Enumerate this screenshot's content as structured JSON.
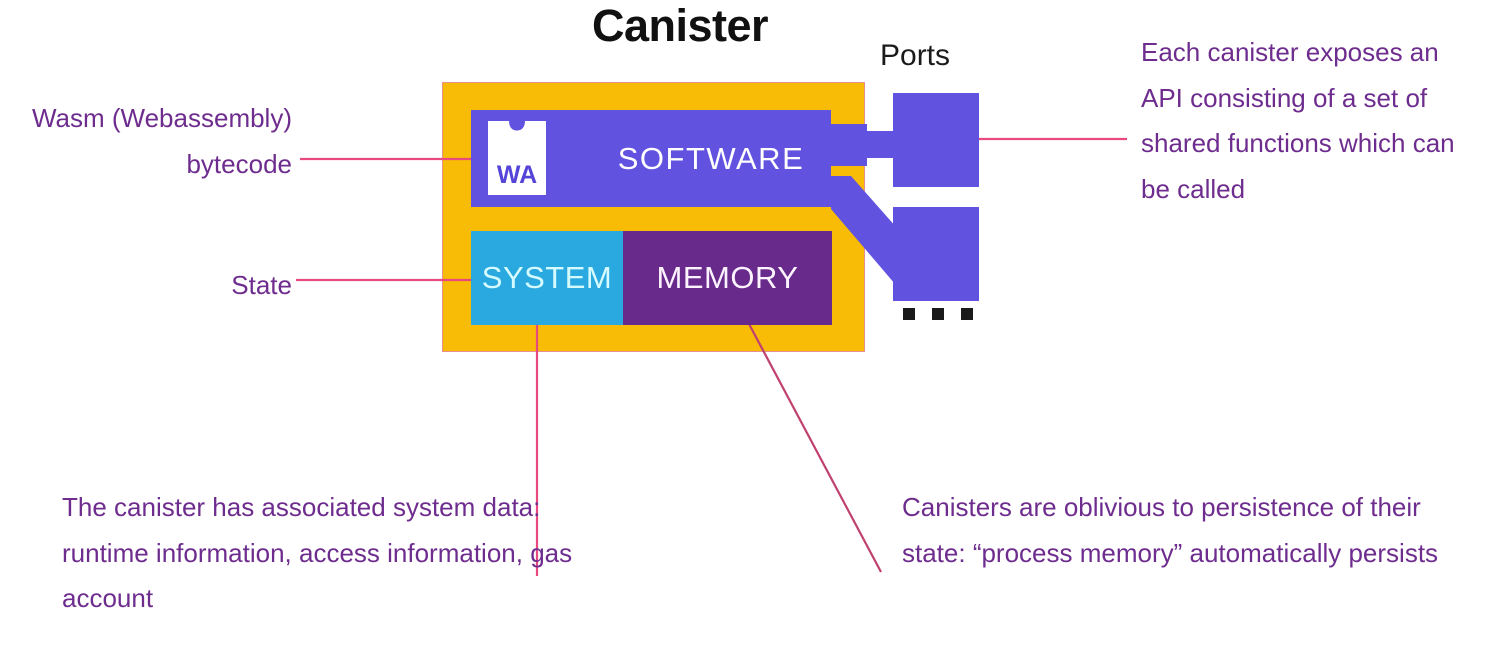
{
  "diagram": {
    "title": "Canister",
    "ports_label": "Ports",
    "blocks": {
      "software": "SOFTWARE",
      "system": "SYSTEM",
      "memory": "MEMORY",
      "wasm_logo_text": "WA"
    },
    "annotations": {
      "wasm": "Wasm (Webassembly) bytecode",
      "state": "State",
      "api": "Each canister exposes an API consisting of a set of shared functions which can be called",
      "system_data": "The canister has associated system data: runtime information, access information, gas account",
      "memory_persistence": "Canisters are oblivious to persistence of their state: “process memory” automatically persists"
    },
    "colors": {
      "canister_fill": "#f8bc06",
      "canister_border": "#e58f8f",
      "software_fill": "#6153e0",
      "system_fill": "#2aa9e0",
      "system_text": "#d6fbff",
      "memory_fill": "#682b8c",
      "memory_text": "#fdf3ff",
      "port_fill": "#6153e0",
      "annotation_text": "#6e2d8e",
      "leader_line": "#e8497f",
      "leader_dot": "#e3147c",
      "title_text": "#111111",
      "wasm_logo_bg": "#ffffff",
      "wasm_logo_text": "#5544d8"
    }
  }
}
